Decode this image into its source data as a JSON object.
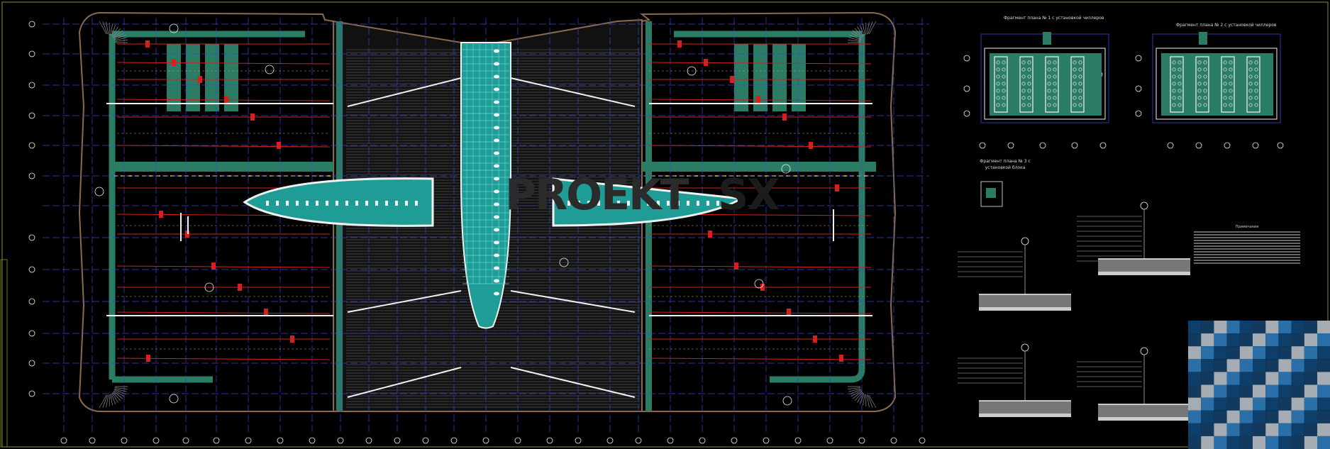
{
  "fragments": [
    {
      "caption": "Фрагмент плана № 1 с установкой чиллеров"
    },
    {
      "caption": "Фрагмент плана № 2 с установкой чиллеров"
    },
    {
      "caption": "Фрагмент плана № 3 с установкой блока"
    }
  ],
  "notes": {
    "title": "Примечания"
  },
  "watermark": {
    "text": "PROEKT",
    "suffix": "SX"
  },
  "colors": {
    "background": "#000000",
    "green": "#2a7d64",
    "red": "#d81e1e",
    "blue": "#3a46d6",
    "white": "#f2f2f2",
    "cyan": "#5fd6d0",
    "teal": "#1f9c96",
    "brown": "#8a6a4a",
    "grey": "#8c8c8c",
    "yellow": "#cfcf3a",
    "olive": "#8d8d2c"
  }
}
